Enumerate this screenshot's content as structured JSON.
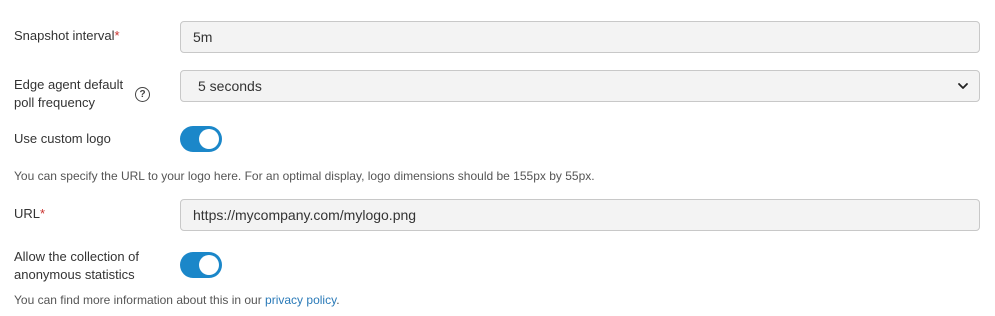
{
  "snapshot": {
    "label": "Snapshot interval",
    "required_mark": "*",
    "value": "5m"
  },
  "edge_poll": {
    "label_line1": "Edge agent default",
    "label_line2": "poll frequency",
    "help_icon": "question-circle-icon",
    "value": "5 seconds"
  },
  "custom_logo": {
    "label": "Use custom logo",
    "enabled": true,
    "note": "You can specify the URL to your logo here. For an optimal display, logo dimensions should be 155px by 55px."
  },
  "url": {
    "label": "URL",
    "required_mark": "*",
    "value": "https://mycompany.com/mylogo.png"
  },
  "statistics": {
    "label_line1": "Allow the collection of",
    "label_line2": "anonymous statistics",
    "enabled": true,
    "note_prefix": "You can find more information about this in our ",
    "link_text": "privacy policy",
    "note_suffix": "."
  },
  "colors": {
    "toggle_on": "#1b87c9",
    "link": "#2a7ab8",
    "required": "#c9302c"
  }
}
